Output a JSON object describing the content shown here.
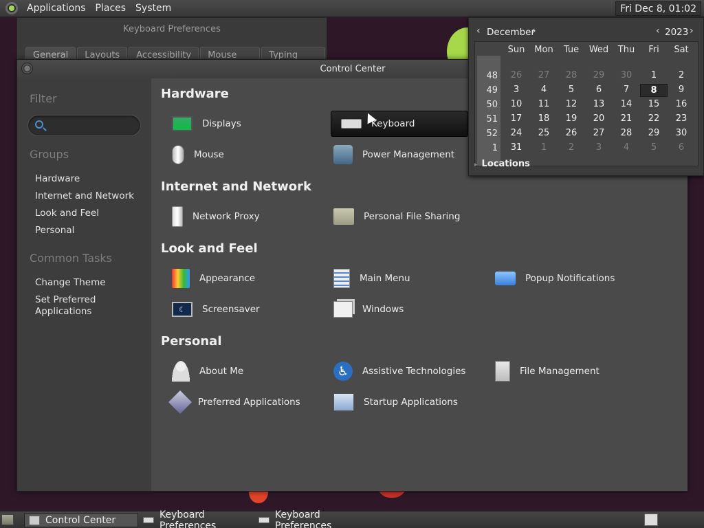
{
  "top_panel": {
    "menus": [
      "Applications",
      "Places",
      "System"
    ],
    "clock": "Fri Dec  8, 01:02"
  },
  "kb_window": {
    "title": "Keyboard Preferences",
    "tabs": [
      "General",
      "Layouts",
      "Accessibility",
      "Mouse Keys",
      "Typing Break"
    ]
  },
  "control_center": {
    "title": "Control Center",
    "sidebar": {
      "filter_heading": "Filter",
      "groups_heading": "Groups",
      "groups": [
        "Hardware",
        "Internet and Network",
        "Look and Feel",
        "Personal"
      ],
      "tasks_heading": "Common Tasks",
      "tasks": [
        "Change Theme",
        "Set Preferred Applications"
      ]
    },
    "sections": {
      "hardware": {
        "title": "Hardware",
        "items": [
          "Displays",
          "Keyboard",
          "Mouse",
          "Power Management"
        ]
      },
      "internet": {
        "title": "Internet and Network",
        "items": [
          "Network Proxy",
          "Personal File Sharing"
        ]
      },
      "look": {
        "title": "Look and Feel",
        "items": [
          "Appearance",
          "Main Menu",
          "Popup Notifications",
          "Screensaver",
          "Windows"
        ]
      },
      "personal": {
        "title": "Personal",
        "items": [
          "About Me",
          "Assistive Technologies",
          "File Management",
          "Preferred Applications",
          "Startup Applications"
        ]
      }
    },
    "selected_item": "Keyboard"
  },
  "calendar": {
    "month": "December",
    "year": "2023",
    "day_names": [
      "Sun",
      "Mon",
      "Tue",
      "Wed",
      "Thu",
      "Fri",
      "Sat"
    ],
    "weeks": [
      {
        "wk": "48",
        "days": [
          "26",
          "27",
          "28",
          "29",
          "30",
          "1",
          "2"
        ],
        "dim": [
          true,
          true,
          true,
          true,
          true,
          false,
          false
        ]
      },
      {
        "wk": "49",
        "days": [
          "3",
          "4",
          "5",
          "6",
          "7",
          "8",
          "9"
        ],
        "dim": [
          false,
          false,
          false,
          false,
          false,
          false,
          false
        ]
      },
      {
        "wk": "50",
        "days": [
          "10",
          "11",
          "12",
          "13",
          "14",
          "15",
          "16"
        ],
        "dim": [
          false,
          false,
          false,
          false,
          false,
          false,
          false
        ]
      },
      {
        "wk": "51",
        "days": [
          "17",
          "18",
          "19",
          "20",
          "21",
          "22",
          "23"
        ],
        "dim": [
          false,
          false,
          false,
          false,
          false,
          false,
          false
        ]
      },
      {
        "wk": "52",
        "days": [
          "24",
          "25",
          "26",
          "27",
          "28",
          "29",
          "30"
        ],
        "dim": [
          false,
          false,
          false,
          false,
          false,
          false,
          false
        ]
      },
      {
        "wk": "1",
        "days": [
          "31",
          "1",
          "2",
          "3",
          "4",
          "5",
          "6"
        ],
        "dim": [
          false,
          true,
          true,
          true,
          true,
          true,
          true
        ]
      }
    ],
    "today": "8",
    "locations_label": "Locations"
  },
  "taskbar": {
    "tasks": [
      "Control Center",
      "Keyboard Preferences",
      "Keyboard Preferences"
    ]
  }
}
